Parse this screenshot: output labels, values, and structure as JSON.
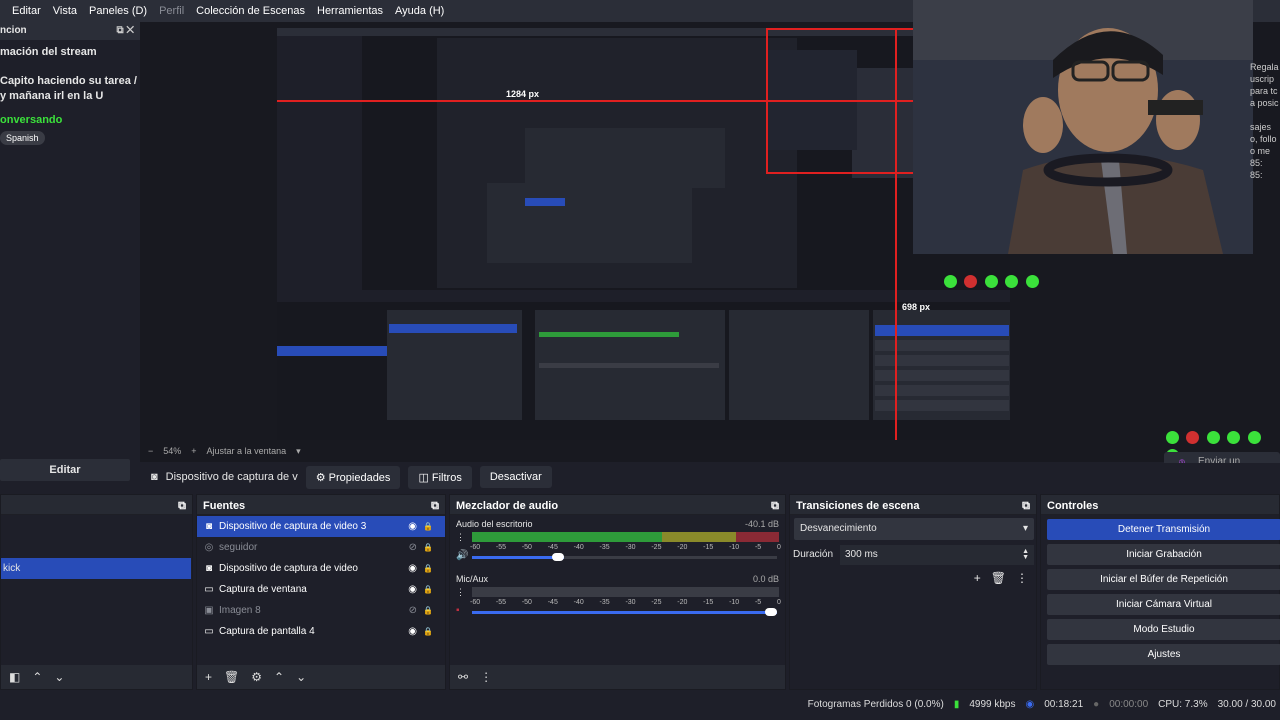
{
  "menu": {
    "items": [
      "Editar",
      "Vista",
      "Paneles (D)",
      "Perfil",
      "Colección de Escenas",
      "Herramientas",
      "Ayuda (H)"
    ]
  },
  "info_dock": {
    "title": "ncion",
    "heading": "mación del stream",
    "stream_title": "Capito haciendo su tarea / y mañana irl en la U",
    "category": "onversando",
    "tag": "Spanish",
    "edit_label": "Editar"
  },
  "preview": {
    "zoom": "54%",
    "fit_label": "Ajustar a la ventana",
    "overlay_width": "1284 px",
    "overlay_height": "698 px",
    "chat_fragments": [
      "Regala",
      "uscrip",
      "para tc",
      "a posic",
      "sajes",
      "o, follo",
      "o me",
      "85:",
      "85:"
    ],
    "send_message": "Enviar un mensaje"
  },
  "source_toolbar": {
    "source_name": "Dispositivo de captura de v",
    "properties": "Propiedades",
    "filters": "Filtros",
    "deactivate": "Desactivar"
  },
  "scenes_dock": {
    "selected_scene": "kick"
  },
  "sources_dock": {
    "title": "Fuentes",
    "items": [
      {
        "label": "Dispositivo de captura de video 3",
        "icon": "camera-icon",
        "selected": true,
        "visible": true
      },
      {
        "label": "seguidor",
        "icon": "browser-icon",
        "selected": false,
        "visible": false
      },
      {
        "label": "Dispositivo de captura de video",
        "icon": "camera-icon",
        "selected": false,
        "visible": true
      },
      {
        "label": "Captura de ventana",
        "icon": "window-icon",
        "selected": false,
        "visible": true
      },
      {
        "label": "Imagen 8",
        "icon": "image-icon",
        "selected": false,
        "visible": false
      },
      {
        "label": "Captura de pantalla 4",
        "icon": "monitor-icon",
        "selected": false,
        "visible": true
      }
    ]
  },
  "mixer_dock": {
    "title": "Mezclador de audio",
    "channels": [
      {
        "name": "Audio del escritorio",
        "db": "-40.1 dB",
        "volume": 0.3
      },
      {
        "name": "Mic/Aux",
        "db": "0.0 dB",
        "volume": 1.0
      }
    ],
    "ticks": [
      "-60",
      "-55",
      "-50",
      "-45",
      "-40",
      "-35",
      "-30",
      "-25",
      "-20",
      "-15",
      "-10",
      "-5",
      "0"
    ]
  },
  "transitions_dock": {
    "title": "Transiciones de escena",
    "selected": "Desvanecimiento",
    "duration_label": "Duración",
    "duration_value": "300 ms"
  },
  "controls_dock": {
    "title": "Controles",
    "buttons": [
      "Detener Transmisión",
      "Iniciar Grabación",
      "Iniciar el Búfer de Repetición",
      "Iniciar Cámara Virtual",
      "Modo Estudio",
      "Ajustes"
    ]
  },
  "status": {
    "dropped_frames": "Fotogramas Perdidos 0 (0.0%)",
    "bitrate": "4999 kbps",
    "time": "00:18:21",
    "rec_time": "00:00:00",
    "cpu": "CPU: 7.3%",
    "fps": "30.00 / 30.00"
  },
  "colors": {
    "accent": "#284cb8",
    "overlay_red": "#e02020",
    "live_green": "#3be13b"
  }
}
